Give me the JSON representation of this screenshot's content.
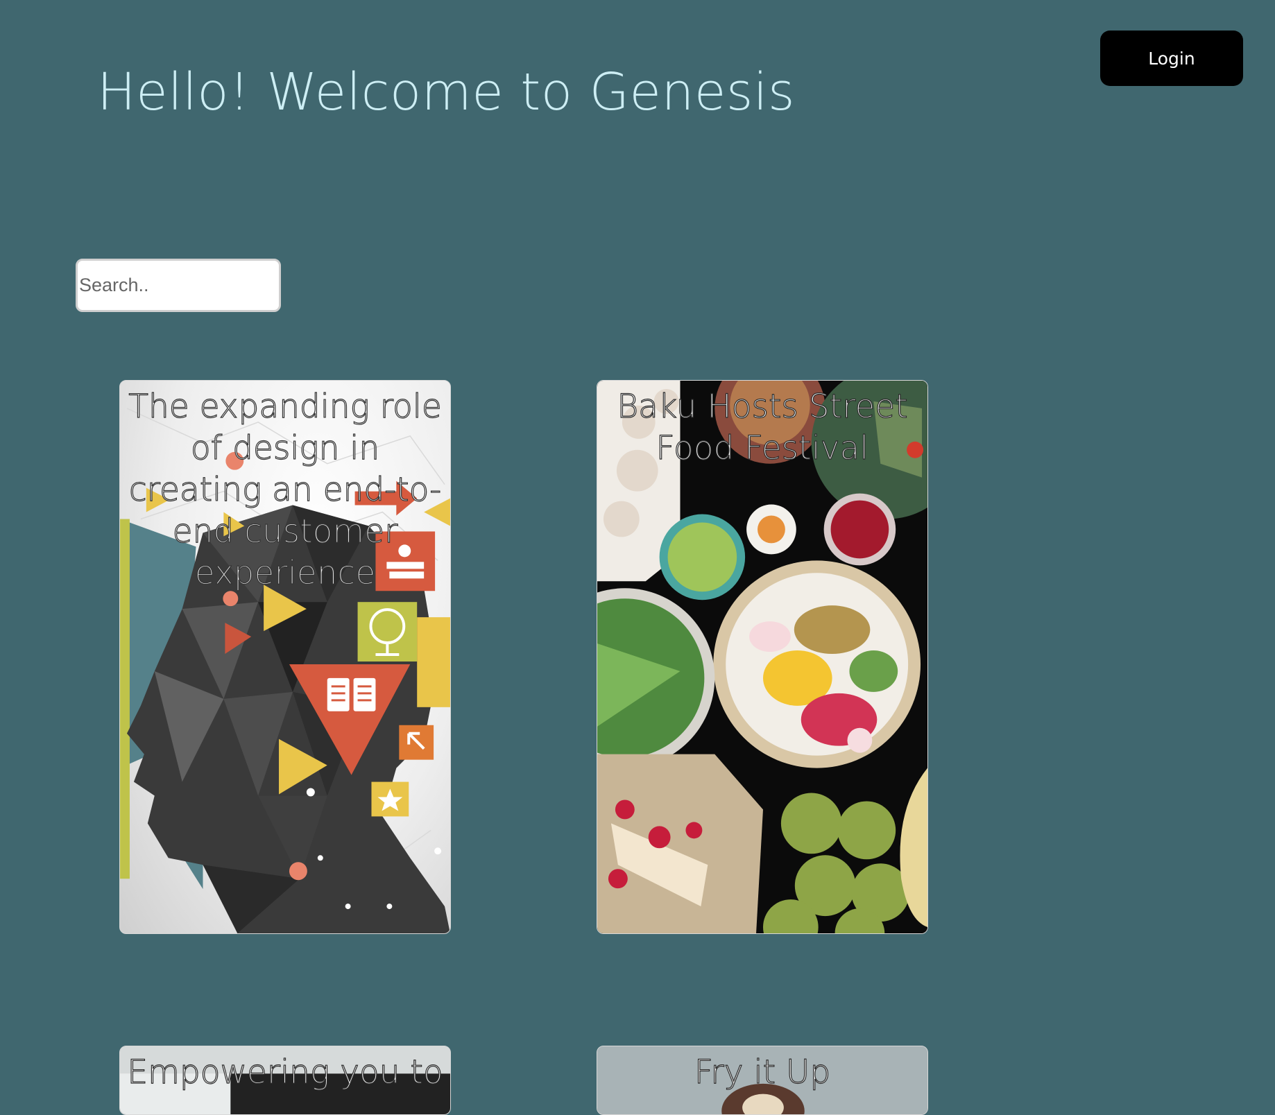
{
  "header": {
    "title": "Hello! Welcome to Genesis",
    "login_label": "Login"
  },
  "search": {
    "placeholder": "Search.."
  },
  "cards": [
    {
      "title": "The expanding role of design in creating an end-to-end customer experience",
      "image": "design-head-illustration"
    },
    {
      "title": "Baku Hosts Street Food Festival",
      "image": "food-table-photo"
    },
    {
      "title": "Empowering you to",
      "image": "empowering-photo"
    },
    {
      "title": "Fry it Up",
      "image": "fried-food-photo"
    }
  ],
  "colors": {
    "background": "#40676f",
    "title": "#cdeef4",
    "login_button": "#000000"
  }
}
